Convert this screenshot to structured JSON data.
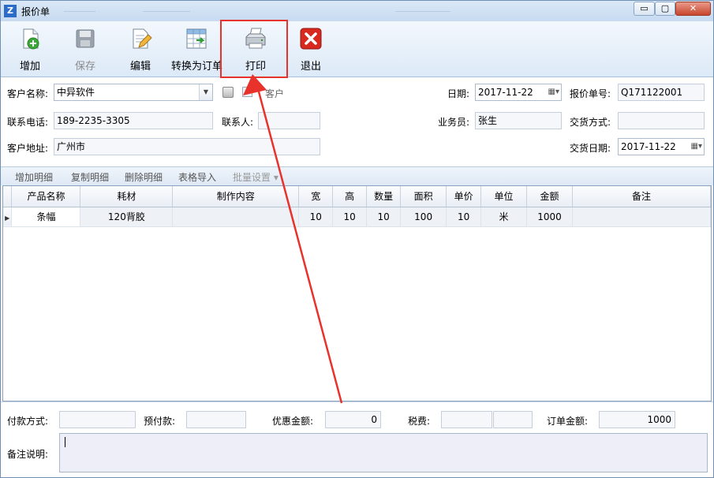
{
  "window": {
    "title": "报价单",
    "controls": {
      "minimize": "▭",
      "maximize": "▢",
      "close": "✕"
    }
  },
  "toolbar": {
    "buttons": [
      {
        "label": "增加",
        "icon": "add-document-icon",
        "enabled": true
      },
      {
        "label": "保存",
        "icon": "save-icon",
        "enabled": false
      },
      {
        "label": "编辑",
        "icon": "edit-document-icon",
        "enabled": true
      },
      {
        "label": "转换为订单",
        "icon": "convert-to-order-icon",
        "enabled": true
      },
      {
        "label": "打印",
        "icon": "printer-icon",
        "enabled": true
      },
      {
        "label": "退出",
        "icon": "exit-icon",
        "enabled": true
      }
    ]
  },
  "form": {
    "customer_name_label": "客户名称:",
    "customer_name_value": "中异软件",
    "new_customer_label": "客户",
    "phone_label": "联系电话:",
    "phone_value": "189-2235-3305",
    "contact_label": "联系人:",
    "contact_value": "",
    "address_label": "客户地址:",
    "address_value": "广州市",
    "date_label": "日期:",
    "date_value": "2017-11-22",
    "quote_no_label": "报价单号:",
    "quote_no_value": "Q171122001",
    "salesperson_label": "业务员:",
    "salesperson_value": "张生",
    "delivery_method_label": "交货方式:",
    "delivery_method_value": "",
    "delivery_date_label": "交货日期:",
    "delivery_date_value": "2017-11-22"
  },
  "grid_toolbar": {
    "items": [
      {
        "label": "增加明细",
        "enabled": true
      },
      {
        "label": "复制明细",
        "enabled": true
      },
      {
        "label": "删除明细",
        "enabled": true
      },
      {
        "label": "表格导入",
        "enabled": true
      },
      {
        "label": "批量设置 ▾",
        "enabled": false
      }
    ]
  },
  "table": {
    "columns": [
      "产品名称",
      "耗材",
      "制作内容",
      "宽",
      "高",
      "数量",
      "面积",
      "单价",
      "单位",
      "金额",
      "备注"
    ],
    "rows": [
      {
        "product": "条幅",
        "material": "120背胶",
        "content": "",
        "width": "10",
        "height": "10",
        "quantity": "10",
        "area": "100",
        "unit_price": "10",
        "unit": "米",
        "amount": "1000",
        "remark": ""
      }
    ]
  },
  "footer": {
    "payment_method_label": "付款方式:",
    "payment_method_value": "",
    "prepay_label": "预付款:",
    "prepay_value": "",
    "discount_label": "优惠金额:",
    "discount_value": "0",
    "tax_label": "税费:",
    "tax_value": "",
    "order_amount_label": "订单金额:",
    "order_amount_value": "1000",
    "remark_label": "备注说明:",
    "remark_value": ""
  },
  "colors": {
    "highlight_box": "#e8322c",
    "annotation_arrow": "#e8322c",
    "toolbar_gradient_top": "#f3f8fd",
    "toolbar_gradient_bottom": "#dce9f7"
  }
}
